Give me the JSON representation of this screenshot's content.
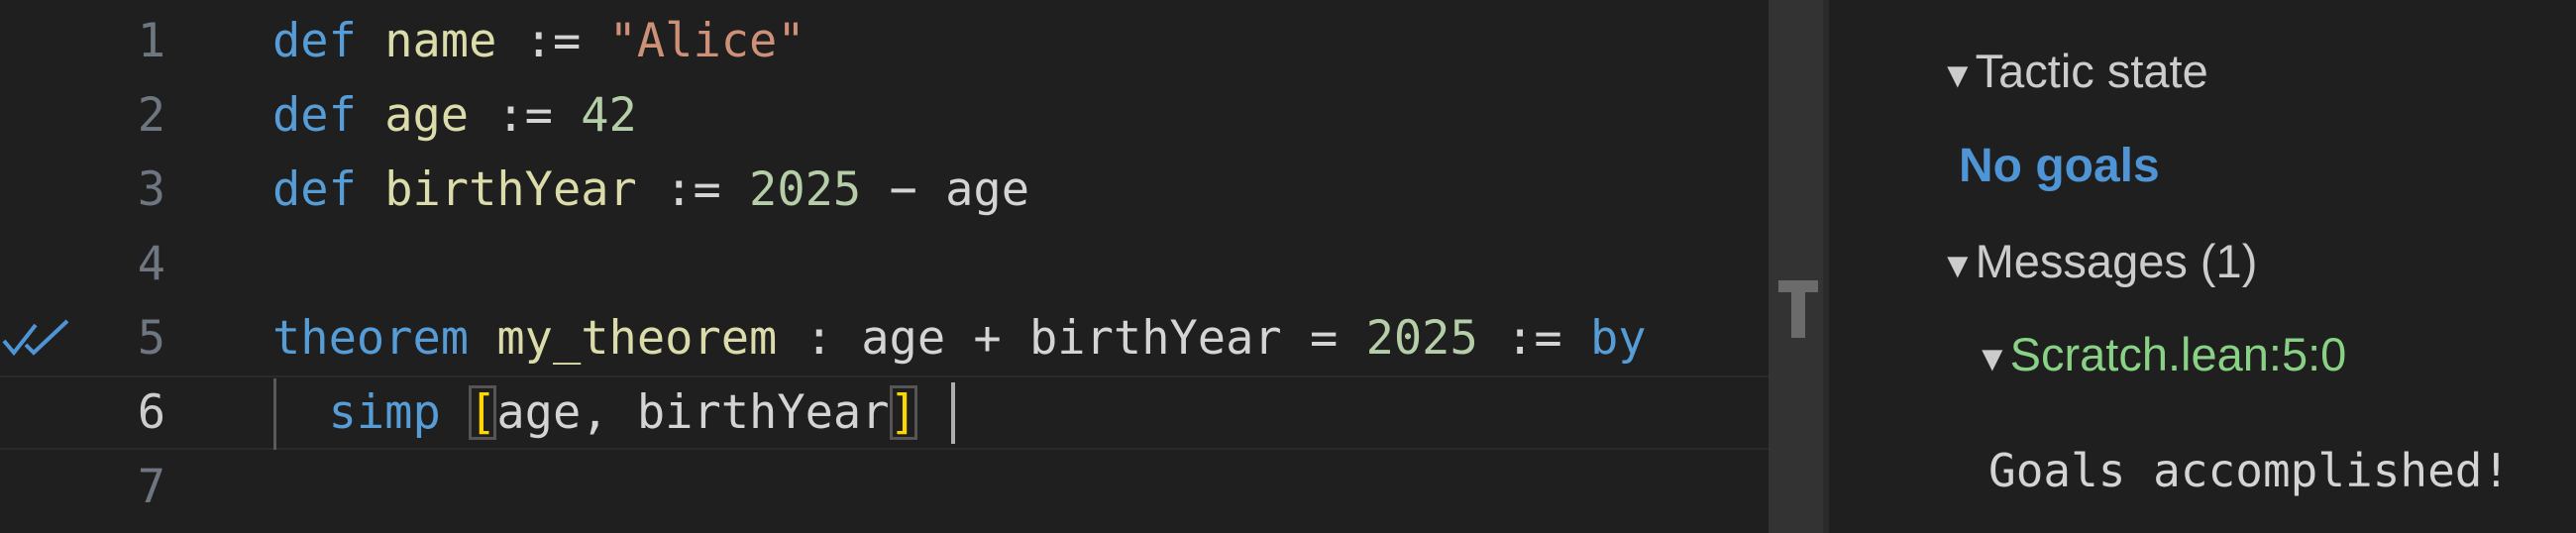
{
  "editor": {
    "lines": [
      {
        "number": "1",
        "tokens": [
          "def",
          " ",
          "name",
          " := ",
          "\"Alice\""
        ]
      },
      {
        "number": "2",
        "tokens": [
          "def",
          " ",
          "age",
          " := ",
          "42"
        ]
      },
      {
        "number": "3",
        "tokens": [
          "def",
          " ",
          "birthYear",
          " := ",
          "2025",
          " − age"
        ]
      },
      {
        "number": "4",
        "tokens": []
      },
      {
        "number": "5",
        "tokens": [
          "theorem",
          " ",
          "my_theorem",
          " : age + birthYear = ",
          "2025",
          " := ",
          "by"
        ]
      },
      {
        "number": "6",
        "tokens": [
          "  ",
          "simp",
          " ",
          "[",
          "age, birthYear",
          "]"
        ]
      },
      {
        "number": "7",
        "tokens": []
      }
    ],
    "gutter_icon": "double-check-icon",
    "colors": {
      "keyword": "#569cd6",
      "function": "#dcdcaa",
      "string": "#ce9178",
      "number": "#b5cea8",
      "bracket": "#ffd700"
    }
  },
  "infoview": {
    "tactic_state_label": "Tactic state",
    "no_goals": "No goals",
    "messages_label": "Messages (1)",
    "message_file": "Scratch.lean:5:0",
    "message_text": "Goals accomplished!",
    "colors": {
      "no_goals": "#4f95d6",
      "file": "#89d185"
    }
  }
}
